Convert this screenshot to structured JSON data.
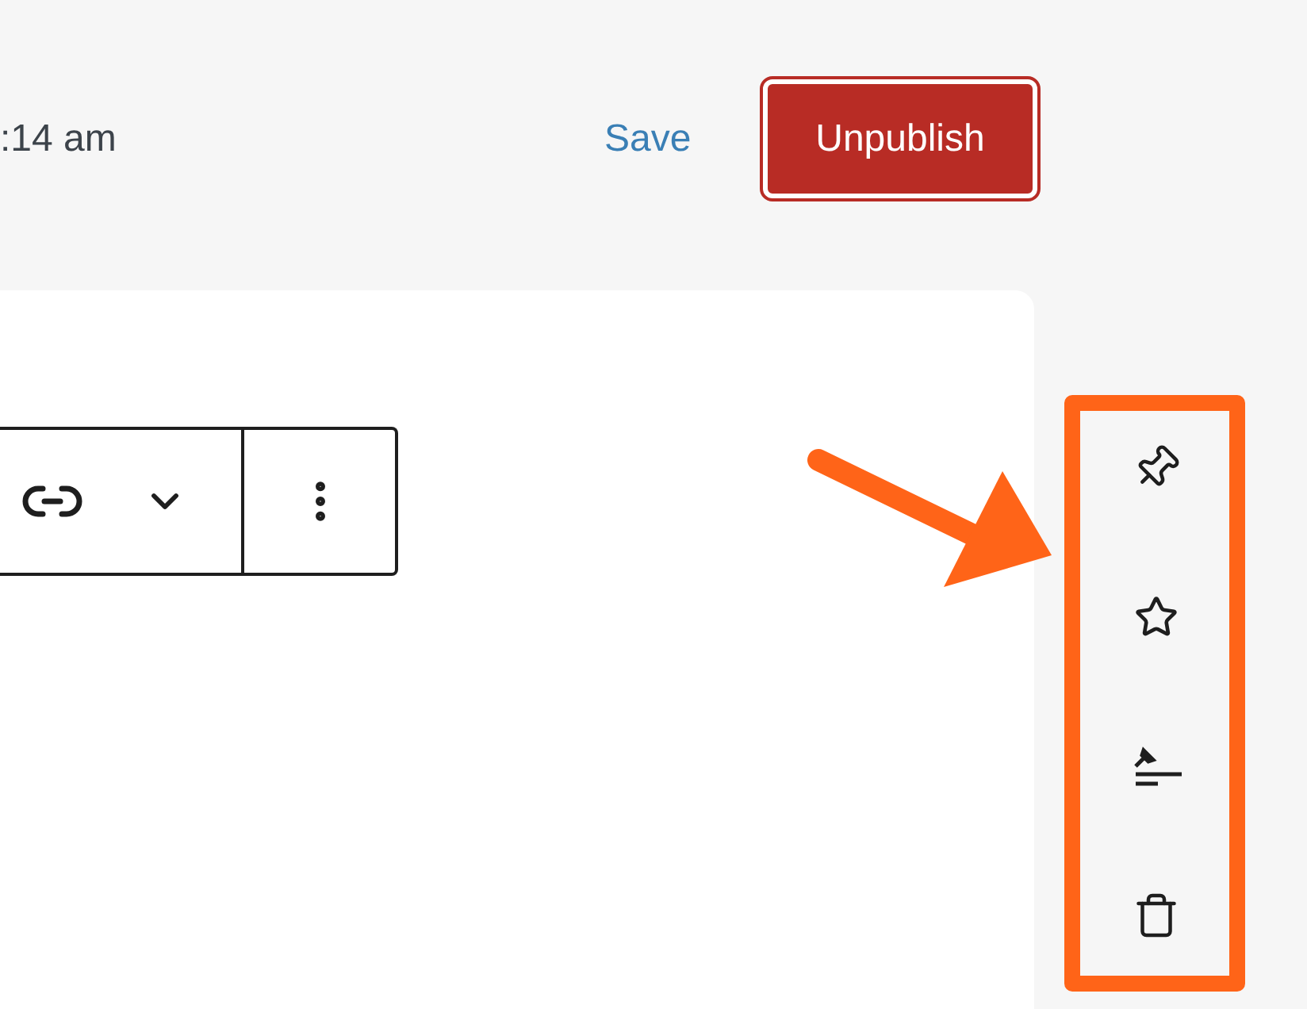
{
  "header": {
    "time": ":14 am",
    "save": "Save",
    "unpublish": "Unpublish"
  }
}
